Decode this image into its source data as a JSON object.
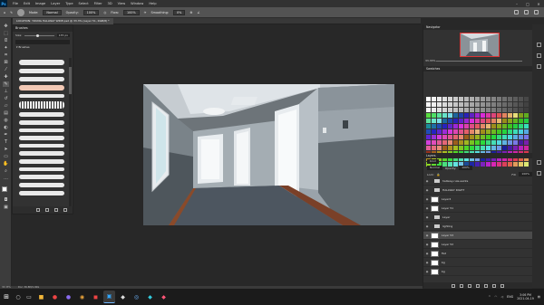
{
  "menubar": {
    "logo": "Ps",
    "items": [
      "File",
      "Edit",
      "Image",
      "Layer",
      "Type",
      "Select",
      "Filter",
      "3D",
      "View",
      "Window",
      "Help"
    ]
  },
  "options": {
    "mode_label": "Mode:",
    "mode_value": "Normal",
    "opacity_label": "Opacity:",
    "opacity_value": "100%",
    "flow_label": "Flow:",
    "flow_value": "100%",
    "smoothing_label": "Smoothing:",
    "smoothing_value": "0%"
  },
  "document": {
    "tab_title": "LOCATION: YOUNG HALLWAY WIDE.psd @ 33.3% (Layer 51, RGB/8) *"
  },
  "brushes_panel": {
    "title": "Brushes",
    "size_label": "Size:",
    "size_value": "135 px",
    "folder_name": "Brushes"
  },
  "navigator": {
    "title": "Navigator",
    "zoom": "33.33%"
  },
  "swatches": {
    "title": "Swatches"
  },
  "layers_panel": {
    "title": "Layers",
    "kind_label": "Kind",
    "mode": "Normal",
    "opacity_label": "Opacity:",
    "opacity_value": "100%",
    "lock_label": "Lock:",
    "fill_label": "Fill:",
    "fill_value": "100%",
    "rows": [
      {
        "name": "hallway-rule-saints",
        "type": "folder"
      },
      {
        "name": "HALLWAY RIGHT",
        "type": "folder"
      },
      {
        "name": "Layer4",
        "type": "layer"
      },
      {
        "name": "Layer 51",
        "type": "layer"
      },
      {
        "name": "Layer",
        "type": "folder"
      },
      {
        "name": "lighting",
        "type": "folder"
      },
      {
        "name": "Layer 53",
        "type": "layer",
        "selected": true
      },
      {
        "name": "Layer 52",
        "type": "layer"
      },
      {
        "name": "flat",
        "type": "layer"
      },
      {
        "name": "bg",
        "type": "layer"
      },
      {
        "name": "bg",
        "type": "layer"
      }
    ]
  },
  "status": {
    "zoom": "33.33%",
    "doc": "Doc: 36.8M/1.00G"
  },
  "taskbar": {
    "lang": "ENG",
    "time": "3:06 PM",
    "date": "2021-04-19"
  },
  "colors": {
    "accent": "#31a8ff",
    "panel_bg": "#323232",
    "canvas_bg": "#282828",
    "selection": "#4b4b4b"
  }
}
